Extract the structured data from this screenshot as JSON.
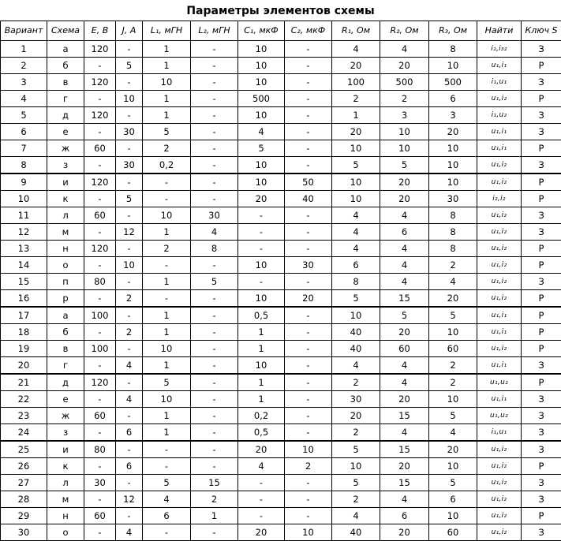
{
  "title": "Параметры элементов схемы",
  "columns": [
    "Вариант",
    "Схема",
    "E, B",
    "J, A",
    "L₁, мГН",
    "L₂, мГН",
    "C₁, мкФ",
    "C₂, мкФ",
    "R₁, Ом",
    "R₂, Ом",
    "R₃, Ом",
    "Найти",
    "Ключ S"
  ],
  "rows": [
    [
      "1",
      "а",
      "120",
      "-",
      "1",
      "-",
      "10",
      "-",
      "4",
      "4",
      "8",
      "i₁,i₃₂",
      "З"
    ],
    [
      "2",
      "б",
      "-",
      "5",
      "1",
      "-",
      "10",
      "-",
      "20",
      "20",
      "10",
      "u₁,i₁",
      "Р"
    ],
    [
      "3",
      "в",
      "120",
      "-",
      "10",
      "-",
      "10",
      "-",
      "100",
      "500",
      "500",
      "i₁,u₁",
      "З"
    ],
    [
      "4",
      "г",
      "-",
      "10",
      "1",
      "-",
      "500",
      "-",
      "2",
      "2",
      "6",
      "u₁,i₂",
      "Р"
    ],
    [
      "5",
      "д",
      "120",
      "-",
      "1",
      "-",
      "10",
      "-",
      "1",
      "3",
      "3",
      "i₁,u₂",
      "З"
    ],
    [
      "6",
      "е",
      "-",
      "30",
      "5",
      "-",
      "4",
      "-",
      "20",
      "10",
      "20",
      "u₁,i₁",
      "З"
    ],
    [
      "7",
      "ж",
      "60",
      "-",
      "2",
      "-",
      "5",
      "-",
      "10",
      "10",
      "10",
      "u₁,i₁",
      "Р"
    ],
    [
      "8",
      "з",
      "-",
      "30",
      "0,2",
      "-",
      "10",
      "-",
      "5",
      "5",
      "10",
      "u₁,i₂",
      "З"
    ],
    [
      "9",
      "и",
      "120",
      "-",
      "-",
      "-",
      "10",
      "50",
      "10",
      "20",
      "10",
      "u₁,i₂",
      "Р"
    ],
    [
      "10",
      "к",
      "-",
      "5",
      "-",
      "-",
      "20",
      "40",
      "10",
      "20",
      "30",
      "i₂,i₂",
      "Р"
    ],
    [
      "11",
      "л",
      "60",
      "-",
      "10",
      "30",
      "-",
      "-",
      "4",
      "4",
      "8",
      "u₁,i₂",
      "З"
    ],
    [
      "12",
      "м",
      "-",
      "12",
      "1",
      "4",
      "-",
      "-",
      "4",
      "6",
      "8",
      "u₁,i₂",
      "З"
    ],
    [
      "13",
      "н",
      "120",
      "-",
      "2",
      "8",
      "-",
      "-",
      "4",
      "4",
      "8",
      "u₁,i₂",
      "Р"
    ],
    [
      "14",
      "о",
      "-",
      "10",
      "-",
      "-",
      "10",
      "30",
      "6",
      "4",
      "2",
      "u₁,i₂",
      "Р"
    ],
    [
      "15",
      "п",
      "80",
      "-",
      "1",
      "5",
      "-",
      "-",
      "8",
      "4",
      "4",
      "u₁,i₂",
      "З"
    ],
    [
      "16",
      "р",
      "-",
      "2",
      "-",
      "-",
      "10",
      "20",
      "5",
      "15",
      "20",
      "u₁,i₂",
      "Р"
    ],
    [
      "17",
      "а",
      "100",
      "-",
      "1",
      "-",
      "0,5",
      "-",
      "10",
      "5",
      "5",
      "u₁,i₁",
      "Р"
    ],
    [
      "18",
      "б",
      "-",
      "2",
      "1",
      "-",
      "1",
      "-",
      "40",
      "20",
      "10",
      "u₁,i₁",
      "Р"
    ],
    [
      "19",
      "в",
      "100",
      "-",
      "10",
      "-",
      "1",
      "-",
      "40",
      "60",
      "60",
      "u₁,i₂",
      "Р"
    ],
    [
      "20",
      "г",
      "-",
      "4",
      "1",
      "-",
      "10",
      "-",
      "4",
      "4",
      "2",
      "u₁,i₁",
      "З"
    ],
    [
      "21",
      "д",
      "120",
      "-",
      "5",
      "-",
      "1",
      "-",
      "2",
      "4",
      "2",
      "u₁,u₂",
      "Р"
    ],
    [
      "22",
      "е",
      "-",
      "4",
      "10",
      "-",
      "1",
      "-",
      "30",
      "20",
      "10",
      "u₁,i₁",
      "З"
    ],
    [
      "23",
      "ж",
      "60",
      "-",
      "1",
      "-",
      "0,2",
      "-",
      "20",
      "15",
      "5",
      "u₁,u₂",
      "З"
    ],
    [
      "24",
      "з",
      "-",
      "6",
      "1",
      "-",
      "0,5",
      "-",
      "2",
      "4",
      "4",
      "i₁,u₁",
      "З"
    ],
    [
      "25",
      "и",
      "80",
      "-",
      "-",
      "-",
      "20",
      "10",
      "5",
      "15",
      "20",
      "u₁,i₂",
      "З"
    ],
    [
      "26",
      "к",
      "-",
      "6",
      "-",
      "-",
      "4",
      "2",
      "10",
      "20",
      "10",
      "u₁,i₂",
      "Р"
    ],
    [
      "27",
      "л",
      "30",
      "-",
      "5",
      "15",
      "-",
      "-",
      "5",
      "15",
      "5",
      "u₁,i₂",
      "З"
    ],
    [
      "28",
      "м",
      "-",
      "12",
      "4",
      "2",
      "-",
      "-",
      "2",
      "4",
      "6",
      "u₁,i₂",
      "З"
    ],
    [
      "29",
      "н",
      "60",
      "-",
      "6",
      "1",
      "-",
      "-",
      "4",
      "6",
      "10",
      "u₁,i₂",
      "Р"
    ],
    [
      "30",
      "о",
      "-",
      "4",
      "-",
      "-",
      "20",
      "10",
      "40",
      "20",
      "60",
      "u₁,i₂",
      "З"
    ]
  ]
}
